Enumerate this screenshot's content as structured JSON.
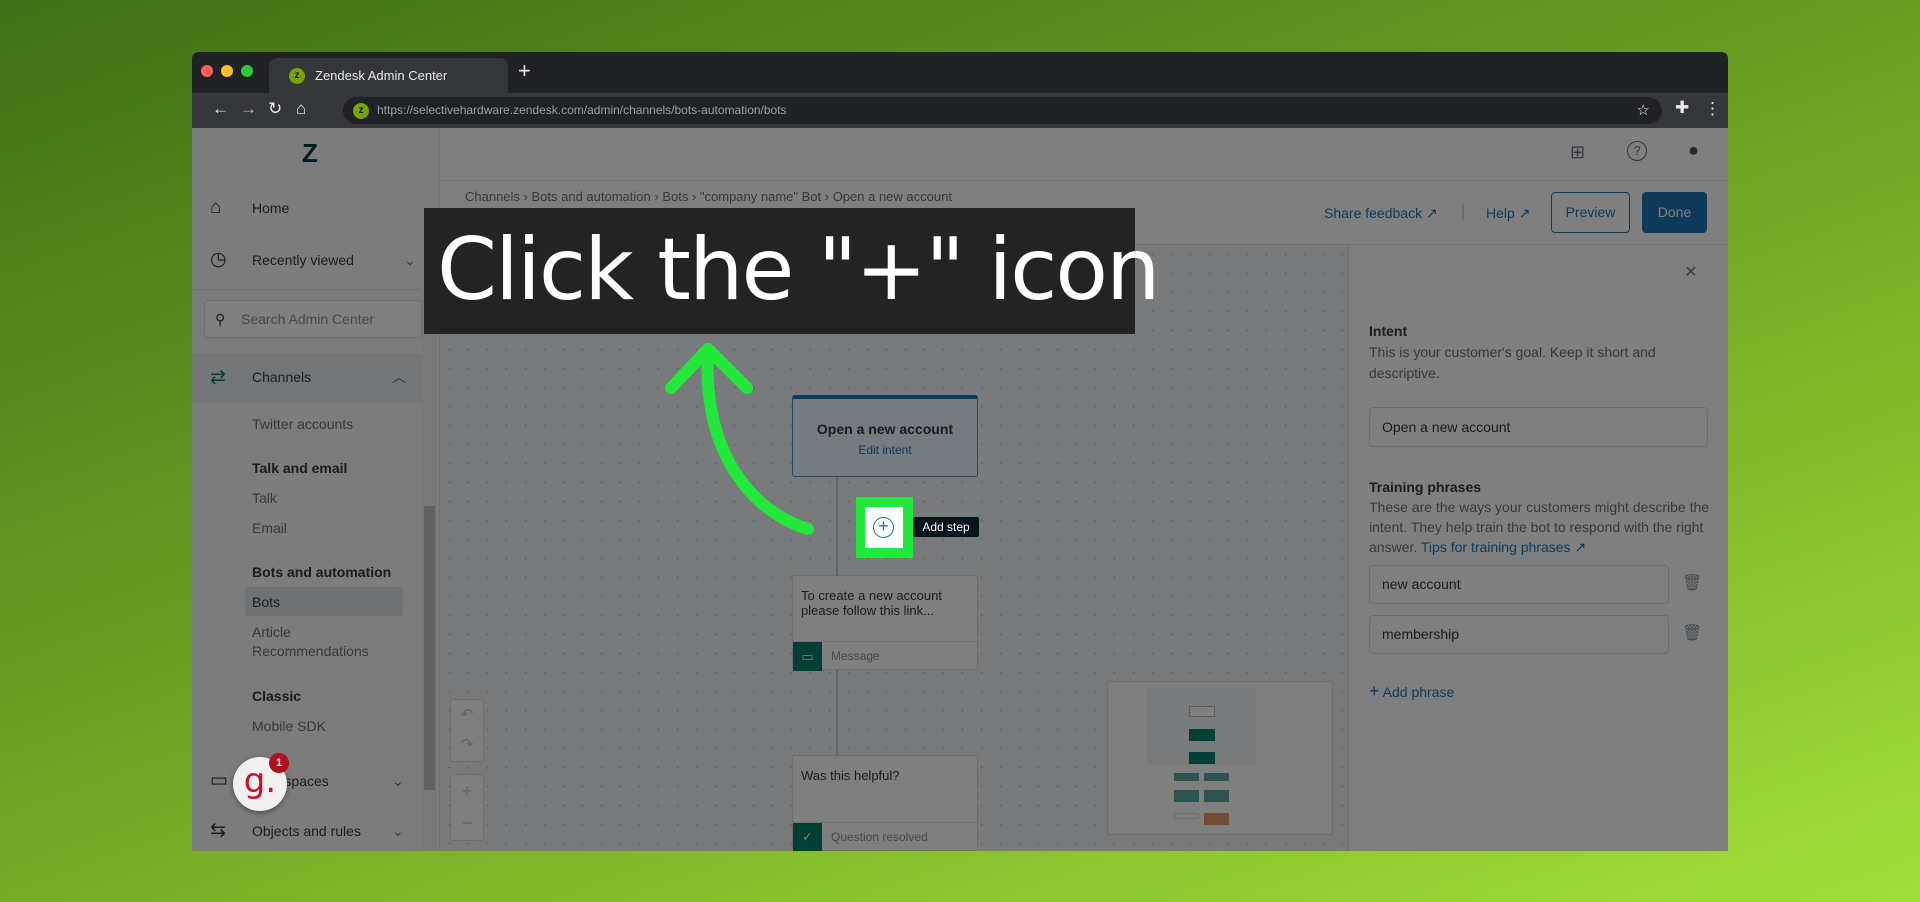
{
  "browser": {
    "tab_title": "Zendesk Admin Center",
    "url": "https://selectivehardware.zendesk.com/admin/channels/bots-automation/bots",
    "new_tab": "+"
  },
  "sidebar": {
    "home": "Home",
    "recently_viewed": "Recently viewed",
    "search_placeholder": "Search Admin Center",
    "channels": "Channels",
    "twitter": "Twitter accounts",
    "talk_email": "Talk and email",
    "talk": "Talk",
    "email": "Email",
    "bots_automation": "Bots and automation",
    "bots": "Bots",
    "article_1": "Article",
    "article_2": "Recommendations",
    "classic": "Classic",
    "mobile_sdk": "Mobile SDK",
    "workspaces": "Workspaces",
    "objects_rules": "Objects and rules"
  },
  "guide_badge": {
    "letter": "g.",
    "count": "1"
  },
  "breadcrumb": [
    "Channels",
    "Bots and automation",
    "Bots",
    "\"company name\" Bot",
    "Open a new account"
  ],
  "header": {
    "share_feedback": "Share feedback",
    "help": "Help",
    "preview": "Preview",
    "done": "Done"
  },
  "flow": {
    "intent_title": "Open a new account",
    "edit_intent": "Edit intent",
    "add_step": "Add step",
    "message_text": "To create a new account please follow this link...",
    "message_label": "Message",
    "question_text": "Was this helpful?",
    "question_label": "Question resolved"
  },
  "panel": {
    "intent_label": "Intent",
    "intent_desc": "This is your customer's goal. Keep it short and descriptive.",
    "intent_value": "Open a new account",
    "training_label": "Training phrases",
    "training_desc": "These are the ways your customers might describe the intent. They help train the bot to respond with the right answer.",
    "tips_link": "Tips for training phrases",
    "phrases": [
      "new account",
      "membership"
    ],
    "add_phrase": "Add phrase"
  },
  "overlay": {
    "instruction": "Click the \"+\" icon",
    "highlight_color": "#22e83c"
  },
  "colors": {
    "accent": "#1f73b7",
    "done": "#1f73b7",
    "bot_green": "#037f6b"
  }
}
